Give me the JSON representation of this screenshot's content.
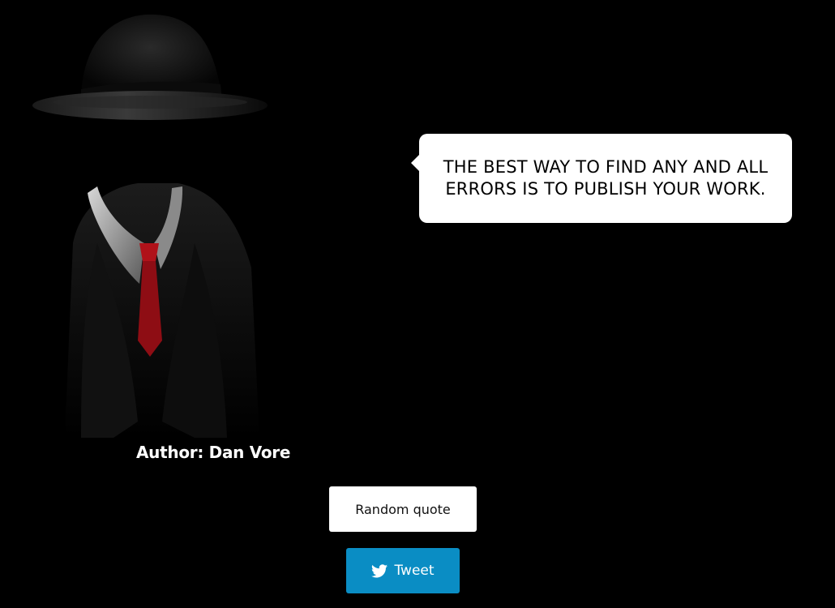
{
  "quote": {
    "text": "The best way to find any and all errors is to publish your work."
  },
  "author": {
    "label": "Author: Dan Vore"
  },
  "buttons": {
    "random_label": "Random quote",
    "tweet_label": "Tweet",
    "tweet_icon": "twitter-bird-icon"
  },
  "colors": {
    "background": "#000000",
    "bubble": "#ffffff",
    "tweet_button": "#0a8dc4",
    "tie": "#b0121a"
  }
}
